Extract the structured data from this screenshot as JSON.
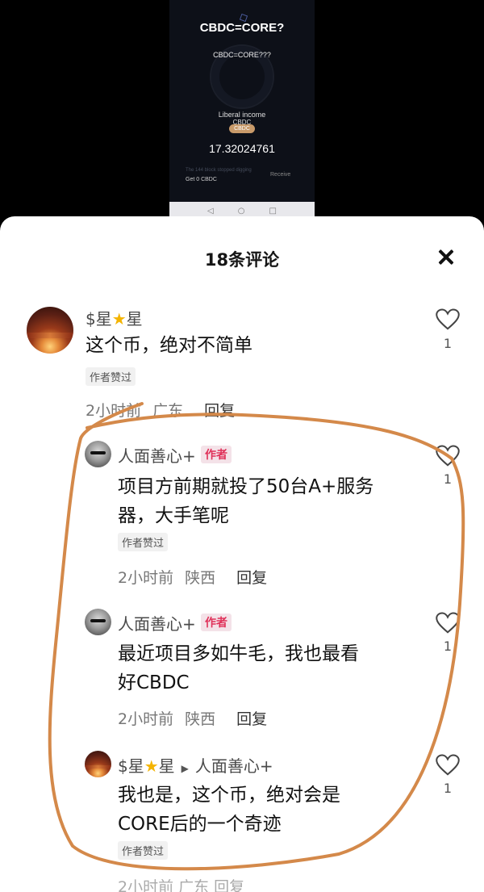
{
  "preview": {
    "title": "CBDC=CORE?",
    "subtitle": "CBDC=CORE???",
    "income_label": "Liberal income",
    "currency": "CBDC",
    "pill": "CBDC",
    "amount": "17.32024761",
    "faint_text": "The 144 block stopped digging",
    "receive": "Receive",
    "get_text": "Get 0 CBDC",
    "nav_back": "◁",
    "nav_home": "○",
    "nav_recent": "□"
  },
  "sheet": {
    "title": "18条评论",
    "close_glyph": ""
  },
  "comments": [
    {
      "user_prefix": "$星",
      "user_suffix": "星",
      "text": "这个币，绝对不简单",
      "liked_badge": "作者赞过",
      "time": "2小时前",
      "location": "广东",
      "reply": "回复",
      "likes": "1"
    },
    {
      "user": "人面善心+",
      "author_tag": "作者",
      "text_line1": "项目方前期就投了50台A+服务",
      "text_line2": "器，大手笔呢",
      "liked_badge": "作者赞过",
      "time": "2小时前",
      "location": "陕西",
      "reply": "回复",
      "likes": "1"
    },
    {
      "user": "人面善心+",
      "author_tag": "作者",
      "text_line1": "最近项目多如牛毛，我也最看",
      "text_line2": "好CBDC",
      "time": "2小时前",
      "location": "陕西",
      "reply": "回复",
      "likes": "1"
    },
    {
      "user_prefix": "$星",
      "user_suffix": "星",
      "reply_to": "人面善心+",
      "text_line1": "我也是，这个币，绝对会是",
      "text_line2": "CORE后的一个奇迹",
      "liked_badge": "作者赞过",
      "likes": "1"
    }
  ],
  "colors": {
    "accent_author": "#e0325a",
    "annotation_stroke": "#d4894a",
    "star": "#f4b400"
  }
}
